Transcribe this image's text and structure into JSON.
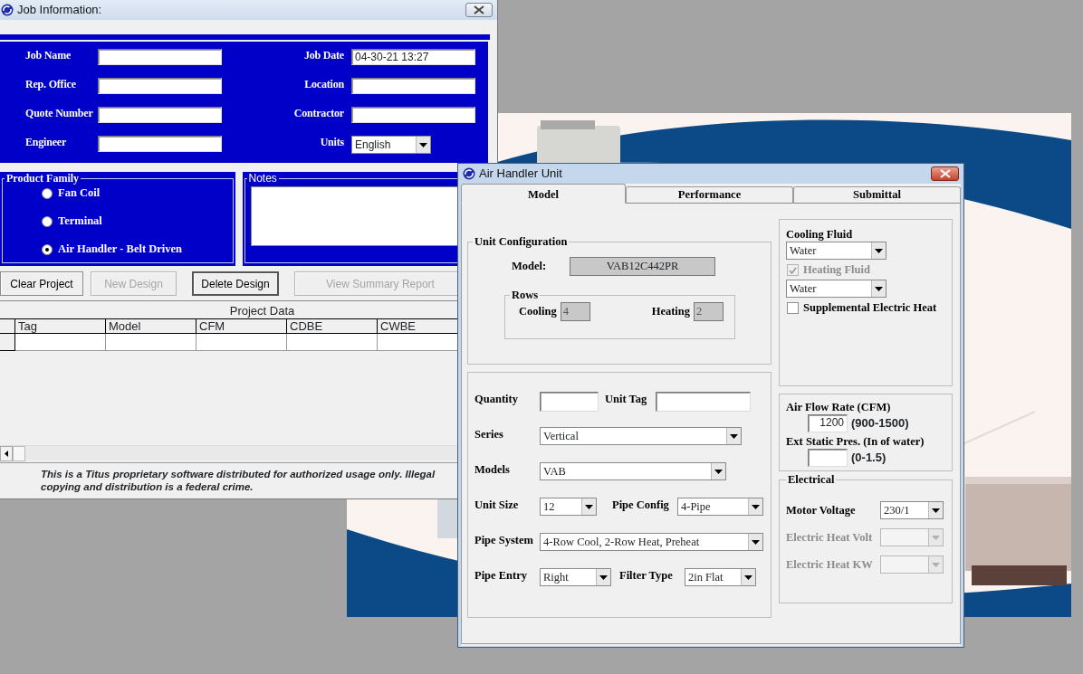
{
  "job_information": {
    "title": "Job Information:",
    "fields": [
      {
        "label": "Job Name",
        "kind": "text"
      },
      {
        "label": "Job Date",
        "kind": "text",
        "value": "04-30-21  13:27"
      },
      {
        "label": "Rep. Office",
        "kind": "text"
      },
      {
        "label": "Location",
        "kind": "text"
      },
      {
        "label": "Quote Number",
        "kind": "text"
      },
      {
        "label": "Contractor",
        "kind": "text"
      },
      {
        "label": "Engineer",
        "kind": "text"
      },
      {
        "label": "Units",
        "kind": "select",
        "value": "English"
      }
    ],
    "product_family": {
      "legend": "Product Family",
      "options": [
        {
          "label": "Fan Coil",
          "selected": false
        },
        {
          "label": "Terminal",
          "selected": false
        },
        {
          "label": "Air Handler - Belt Driven",
          "selected": true
        }
      ]
    },
    "notes": {
      "legend": "Notes"
    },
    "buttons": [
      {
        "label": "Clear Project",
        "disabled": false
      },
      {
        "label": "New Design",
        "disabled": true
      },
      {
        "label": "Delete Design",
        "disabled": false
      },
      {
        "label": "View Summary Report",
        "disabled": true
      }
    ],
    "project_data": {
      "title": "Project Data",
      "columns": [
        "Tag",
        "Model",
        "CFM",
        "CDBE",
        "CWBE"
      ]
    },
    "notice": "This is a Titus proprietary software distributed for authorized usage only. Illegal copying and distribution is a federal crime."
  },
  "air_handler_unit": {
    "title": "Air Handler Unit",
    "tabs": [
      {
        "label": "Model",
        "selected": true
      },
      {
        "label": "Performance",
        "selected": false
      },
      {
        "label": "Submittal",
        "selected": false
      }
    ],
    "unit_configuration": {
      "legend": "Unit Configuration",
      "model_label": "Model:",
      "model": "VAB12C442PR",
      "rows": {
        "legend": "Rows",
        "cooling_label": "Cooling",
        "cooling": "4",
        "heating_label": "Heating",
        "heating": "2"
      }
    },
    "selection": [
      [
        {
          "label": "Quantity",
          "kind": "text"
        },
        {
          "label": "Unit Tag",
          "kind": "text"
        }
      ],
      [
        {
          "label": "Series",
          "kind": "select",
          "value": "Vertical"
        }
      ],
      [
        {
          "label": "Models",
          "kind": "select",
          "value": "VAB"
        }
      ],
      [
        {
          "label": "Unit Size",
          "kind": "select",
          "value": "12"
        },
        {
          "label": "Pipe Config",
          "kind": "select",
          "value": "4-Pipe"
        }
      ],
      [
        {
          "label": "Pipe System",
          "kind": "select",
          "value": "4-Row Cool, 2-Row Heat, Preheat"
        }
      ],
      [
        {
          "label": "Pipe Entry",
          "kind": "select",
          "value": "Right"
        },
        {
          "label": "Filter Type",
          "kind": "select",
          "value": "2in Flat"
        }
      ]
    ],
    "fluids": {
      "cooling_label": "Cooling Fluid",
      "cooling": "Water",
      "heating_fluid": {
        "label": "Heating Fluid",
        "checked": true,
        "disabled": true
      },
      "heating": "Water",
      "supplemental_heat": {
        "label": "Supplemental Electric Heat",
        "checked": false,
        "disabled": false
      }
    },
    "air_flow": {
      "label": "Air Flow Rate (CFM)",
      "value": "1200",
      "range": "(900-1500)",
      "static_label": "Ext Static Pres. (In of water)",
      "static_range": "(0-1.5)"
    },
    "electrical": {
      "legend": "Electrical",
      "rows": [
        {
          "label": "Motor Voltage",
          "value": "230/1",
          "disabled": false
        },
        {
          "label": "Electric Heat Volt",
          "disabled": true
        },
        {
          "label": "Electric Heat KW",
          "disabled": true
        }
      ]
    }
  }
}
